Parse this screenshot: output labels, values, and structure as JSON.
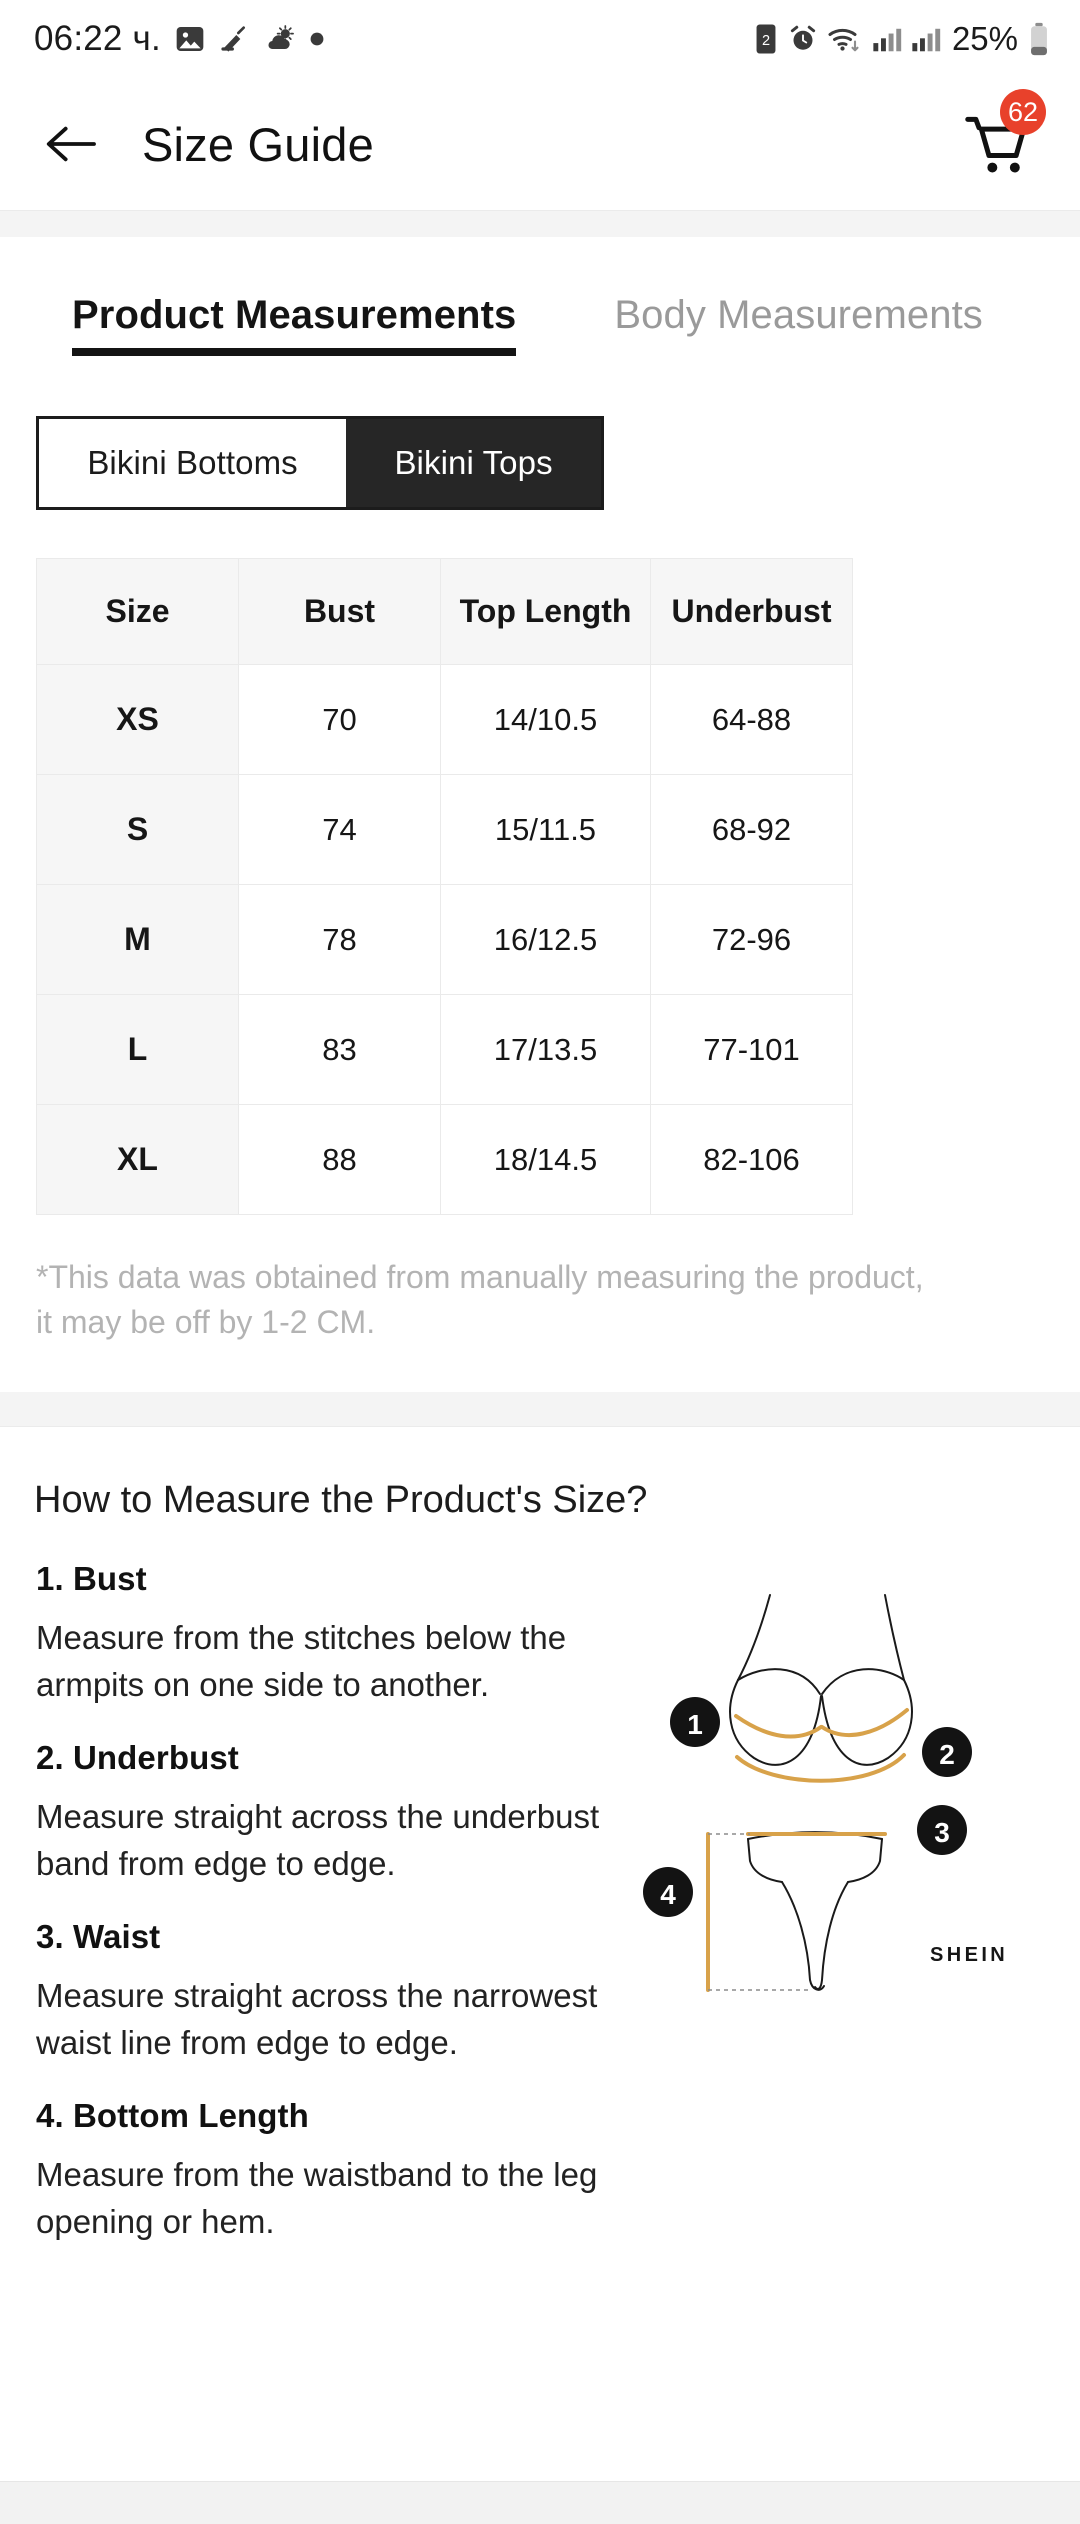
{
  "status_bar": {
    "time": "06:22 ч.",
    "battery_percent": "25%",
    "left_icons": [
      "photo-icon",
      "sweep-icon",
      "weather-icon",
      "dot-icon"
    ],
    "right_icons": [
      "sim-icon",
      "alarm-icon",
      "wifi-icon",
      "signal-icon-1",
      "signal-icon-2",
      "battery-icon"
    ]
  },
  "app_bar": {
    "back_icon": "arrow-left-icon",
    "title": "Size Guide",
    "cart_icon": "shopping-cart-icon",
    "cart_badge": "62"
  },
  "tabs": [
    {
      "label": "Product Measurements",
      "active": true
    },
    {
      "label": "Body Measurements",
      "active": false
    }
  ],
  "segmented": [
    {
      "label": "Bikini Bottoms",
      "selected": false
    },
    {
      "label": "Bikini Tops",
      "selected": true
    }
  ],
  "size_table": {
    "headers": [
      "Size",
      "Bust",
      "Top Length",
      "Underbust"
    ],
    "rows": [
      [
        "XS",
        "70",
        "14/10.5",
        "64-88"
      ],
      [
        "S",
        "74",
        "15/11.5",
        "68-92"
      ],
      [
        "M",
        "78",
        "16/12.5",
        "72-96"
      ],
      [
        "L",
        "83",
        "17/13.5",
        "77-101"
      ],
      [
        "XL",
        "88",
        "18/14.5",
        "82-106"
      ]
    ]
  },
  "disclaimer": "*This data was obtained from manually measuring the product, it may be off by 1-2 CM.",
  "measure": {
    "title": "How to Measure the Product's Size?",
    "steps": [
      {
        "head": "1. Bust",
        "text": "Measure from the stitches below the armpits on one side to another."
      },
      {
        "head": "2. Underbust",
        "text": "Measure straight across the underbust band from edge to edge."
      },
      {
        "head": "3. Waist",
        "text": "Measure straight across the narrowest waist line from edge to edge."
      },
      {
        "head": "4. Bottom Length",
        "text": "Measure from the waistband to the leg opening or hem."
      }
    ],
    "diagram": {
      "markers": [
        "1",
        "2",
        "3",
        "4"
      ],
      "brand": "SHEIN",
      "line_color": "#d8a24a",
      "sketch_color": "#1a1a1a",
      "marker_bg": "#131313"
    }
  },
  "colors": {
    "accent_badge": "#e8412b",
    "active_tab": "#141414",
    "inactive_tab": "#9a9a9a",
    "segment_on_bg": "#262626",
    "table_header_bg": "#f6f6f6",
    "disclaimer_text": "#b3b3b3",
    "band_bg": "#f4f4f4"
  }
}
